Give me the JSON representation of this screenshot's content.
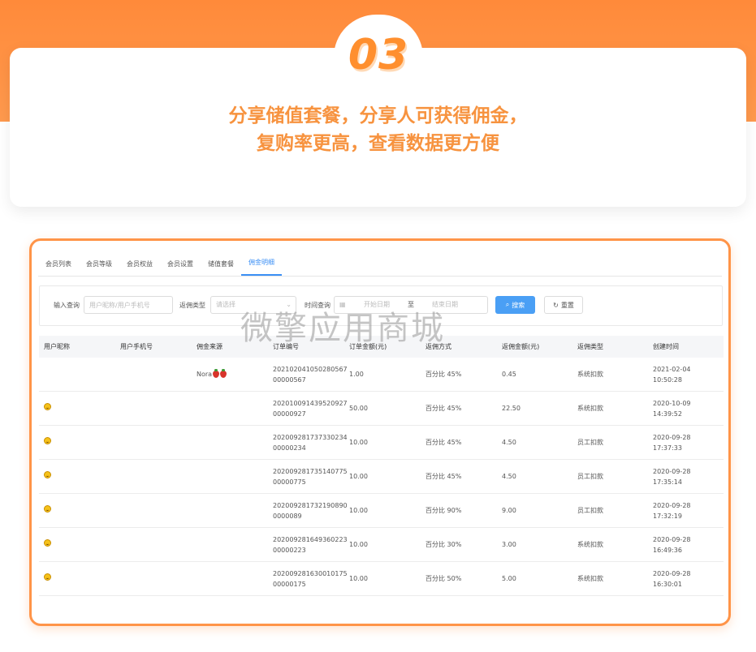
{
  "banner": {
    "step": "03",
    "line1": "分享储值套餐，分享人可获得佣金，",
    "line2": "复购率更高，查看数据更方便"
  },
  "tabs": [
    {
      "label": "会员列表"
    },
    {
      "label": "会员等级"
    },
    {
      "label": "会员权益"
    },
    {
      "label": "会员设置"
    },
    {
      "label": "储值套餐"
    },
    {
      "label": "佣金明细",
      "active": true
    }
  ],
  "filters": {
    "query_label": "输入查询",
    "query_placeholder": "用户昵称/用户手机号",
    "type_label": "返佣类型",
    "type_placeholder": "请选择",
    "time_label": "时间查询",
    "start_placeholder": "开始日期",
    "range_sep": "至",
    "end_placeholder": "结束日期",
    "search_label": "搜索",
    "reset_label": "重置"
  },
  "watermark": "微擎应用商城",
  "table": {
    "headers": [
      "用户昵称",
      "用户手机号",
      "佣金来源",
      "订单编号",
      "订单金额(元)",
      "返佣方式",
      "返佣金额(元)",
      "返佣类型",
      "创建时间"
    ],
    "rows": [
      {
        "nick": "",
        "smile": false,
        "phone": "",
        "source": "Nora",
        "berries": true,
        "order1": "202102041050280567",
        "order2": "00000567",
        "amount": "1.00",
        "method": "百分比 45%",
        "commission": "0.45",
        "type": "系统扣款",
        "date": "2021-02-04",
        "time": "10:50:28"
      },
      {
        "nick": "",
        "smile": true,
        "phone": "",
        "source": "",
        "berries": false,
        "order1": "202010091439520927",
        "order2": "00000927",
        "amount": "50.00",
        "method": "百分比 45%",
        "commission": "22.50",
        "type": "系统扣款",
        "date": "2020-10-09",
        "time": "14:39:52"
      },
      {
        "nick": "",
        "smile": true,
        "phone": "",
        "source": "",
        "berries": false,
        "order1": "202009281737330234",
        "order2": "00000234",
        "amount": "10.00",
        "method": "百分比 45%",
        "commission": "4.50",
        "type": "员工扣款",
        "date": "2020-09-28",
        "time": "17:37:33"
      },
      {
        "nick": "",
        "smile": true,
        "phone": "",
        "source": "",
        "berries": false,
        "order1": "202009281735140775",
        "order2": "00000775",
        "amount": "10.00",
        "method": "百分比 45%",
        "commission": "4.50",
        "type": "员工扣款",
        "date": "2020-09-28",
        "time": "17:35:14"
      },
      {
        "nick": "",
        "smile": true,
        "phone": "",
        "source": "",
        "berries": false,
        "order1": "202009281732190890",
        "order2": "0000089",
        "amount": "10.00",
        "method": "百分比 90%",
        "commission": "9.00",
        "type": "员工扣款",
        "date": "2020-09-28",
        "time": "17:32:19"
      },
      {
        "nick": "",
        "smile": true,
        "phone": "",
        "source": "",
        "berries": false,
        "order1": "202009281649360223",
        "order2": "00000223",
        "amount": "10.00",
        "method": "百分比 30%",
        "commission": "3.00",
        "type": "系统扣款",
        "date": "2020-09-28",
        "time": "16:49:36"
      },
      {
        "nick": "",
        "smile": true,
        "phone": "",
        "source": "",
        "berries": false,
        "order1": "202009281630010175",
        "order2": "00000175",
        "amount": "10.00",
        "method": "百分比 50%",
        "commission": "5.00",
        "type": "系统扣款",
        "date": "2020-09-28",
        "time": "16:30:01"
      }
    ]
  },
  "colors": {
    "brand_orange": "#ff8a3a",
    "accent_blue": "#3b8ff5",
    "headline": "#f7933f"
  },
  "icons": {
    "search": "search-icon",
    "reset": "refresh-icon",
    "calendar": "calendar-icon",
    "dropdown": "chevron-down-icon"
  }
}
